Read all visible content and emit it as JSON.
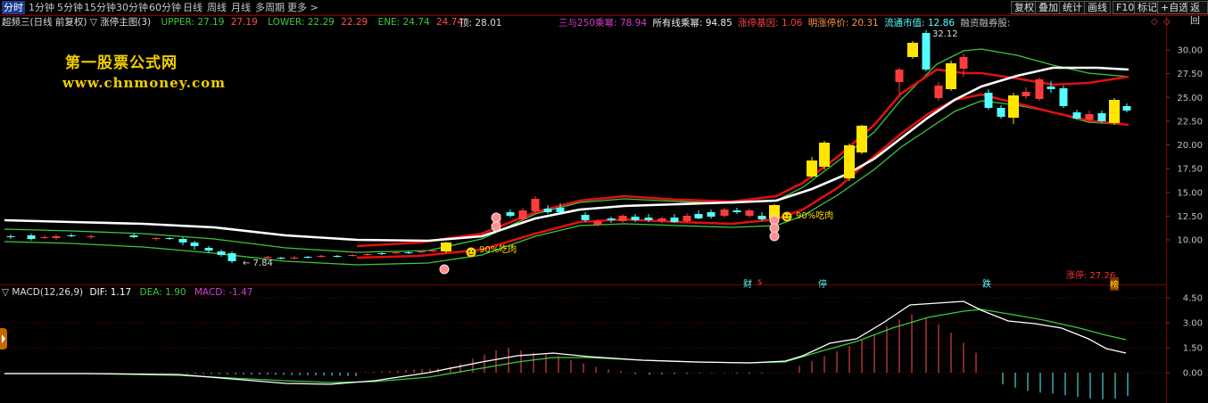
{
  "topbar": {
    "timeframes": [
      "分时",
      "1分钟",
      "5分钟",
      "15分钟",
      "30分钟",
      "60分钟",
      "日线",
      "周线",
      "月线",
      "多周期",
      "更多 >"
    ],
    "active_timeframe": 0,
    "right_buttons": [
      "复权",
      "叠加",
      "统计",
      "画线",
      "F10",
      "标记",
      "+自选",
      "返回"
    ],
    "small_icons": [
      "◇",
      "◇"
    ]
  },
  "legend_main": {
    "prefix": "超频三(日线 前复权) ▽ 涨停主图(3)",
    "upper_label": "UPPER: 27.19",
    "upper_val": "27.19",
    "lower_label": "LOWER: 22.29",
    "lower_val": "22.29",
    "ene_label": "ENE: 24.74",
    "ene_val": "24.74",
    "ding_label": "顶: 28.01",
    "ratio_label": "三与250乘幂:",
    "ratio_val": "78.94",
    "line_ratio_label": "所有线乘幂:",
    "line_ratio_val": "94.85",
    "gene_label": "涨停基因:",
    "gene_val": "1.06",
    "tomorrow_label": "明涨停价:",
    "tomorrow_val": "20.31",
    "float_label": "流通市值:",
    "float_val": "12.86",
    "margin_label": "融资融券股:"
  },
  "legend_macd": {
    "name": "▽ MACD(12,26,9)",
    "dif": "DIF: 1.17",
    "dea": "DEA: 1.90",
    "macd": "MACD: -1.47"
  },
  "brand": {
    "cn": "第一股票公式网",
    "url": "www.chnmoney.com"
  },
  "annotations": {
    "high_mark": "32.12",
    "low_mark": "← 7.84",
    "eat1": "90%吃肉",
    "eat2": "90%吃肉",
    "limit_up": "涨停: 27.26",
    "flag_cai": "财",
    "flag_s": "s",
    "flag_fu": "停",
    "flag_die": "跌",
    "flag_bang": "榜"
  },
  "price_axis": [
    "30.00",
    "27.50",
    "25.00",
    "22.50",
    "20.00",
    "17.50",
    "15.00",
    "12.50",
    "10.00"
  ],
  "macd_axis": [
    "4.50",
    "3.00",
    "1.50",
    "0.00"
  ],
  "colors": {
    "up": "#ff3c3c",
    "down": "#54ffff",
    "yellow": "#ffe600",
    "white": "#ffffff",
    "green": "#3cc83c",
    "red": "#e01010",
    "grid": "#7a0000"
  }
}
